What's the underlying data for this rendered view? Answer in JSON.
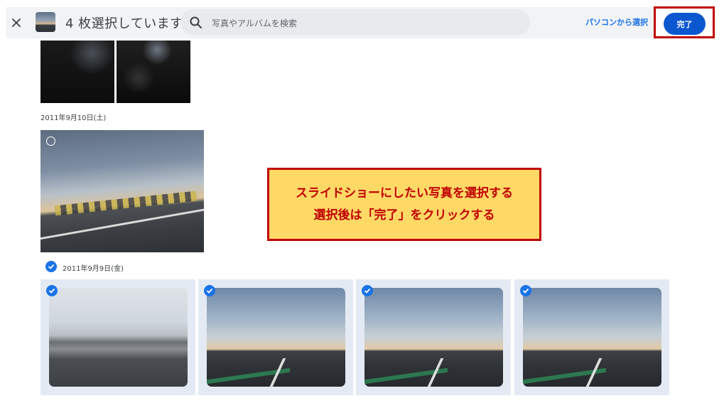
{
  "header": {
    "close_icon": "close-icon",
    "selection_count": "4 枚選択しています",
    "search": {
      "placeholder": "写真やアルバムを検索",
      "value": ""
    },
    "pc_select_label": "パソコンから選択",
    "done_label": "完了"
  },
  "groups": [
    {
      "date": "2011年9月10日(土)"
    },
    {
      "date": "2011年9月9日(金)",
      "selected": true
    }
  ],
  "photos": {
    "top_row": [
      {
        "name": "car-interior-1",
        "selected": false
      },
      {
        "name": "car-interior-2",
        "selected": false
      }
    ],
    "sep10": [
      {
        "name": "sunset-highway",
        "selected": false
      }
    ],
    "sep9": [
      {
        "name": "road-1",
        "selected": true
      },
      {
        "name": "road-2",
        "selected": true
      },
      {
        "name": "road-3",
        "selected": true
      },
      {
        "name": "road-4",
        "selected": true
      }
    ]
  },
  "callout": {
    "line1": "スライドショーにしたい写真を選択する",
    "line2": "選択後は「完了」をクリックする"
  },
  "colors": {
    "accent": "#1a73e8",
    "done_button": "#0b57d0",
    "callout_bg": "#ffd966",
    "callout_border": "#c00000",
    "selected_tile_bg": "#e4eaf4"
  }
}
